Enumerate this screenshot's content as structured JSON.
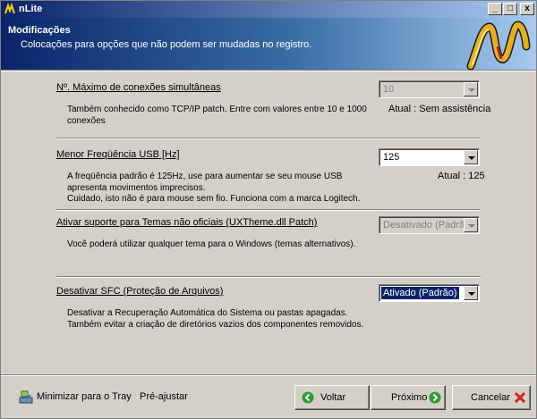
{
  "window": {
    "title": "nLite",
    "min_glyph": "_",
    "max_glyph": "□",
    "close_glyph": "x"
  },
  "header": {
    "title": "Modificações",
    "subtitle": "Colocações para opções que não podem ser mudadas no registro."
  },
  "sections": [
    {
      "label": "Nº. Máximo de conexões simultâneas",
      "combo_value": "10",
      "combo_enabled": false,
      "description": "Também conhecido como TCP/IP patch. Entre com valores entre 10 e 1000 conexões",
      "status": "Atual : Sem assistência"
    },
    {
      "label": "Menor Freqüência USB [Hz]",
      "combo_value": "125",
      "combo_enabled": true,
      "description_line1": "A freqüência padrão é 125Hz, use para aumentar se seu mouse USB apresenta movimentos imprecisos.",
      "description_line2": "Cuidado, isto não é para mouse sem fio. Funciona com a marca Logitech.",
      "status": "Atual : 125"
    },
    {
      "label": "Ativar suporte para Temas não oficiais (UXTheme.dll Patch)",
      "combo_value": "Desativado (Padrão)",
      "combo_enabled": false,
      "description": "Você poderá utilizar qualquer tema para o Windows (temas alternativos)."
    },
    {
      "label": "Desativar SFC (Proteção de Arquivos)",
      "combo_value": "Ativado (Padrão)",
      "combo_enabled": true,
      "description_line1": "Desativar a Recuperação Automática do Sistema ou pastas apagadas.",
      "description_line2": "Também evitar a criação de diretórios vazios dos componentes removidos."
    }
  ],
  "footer": {
    "tray_label": "Minimizar para o Tray",
    "preset_label": "Pré-ajustar",
    "back_label": "Voltar",
    "next_label": "Próximo",
    "cancel_label": "Cancelar"
  }
}
